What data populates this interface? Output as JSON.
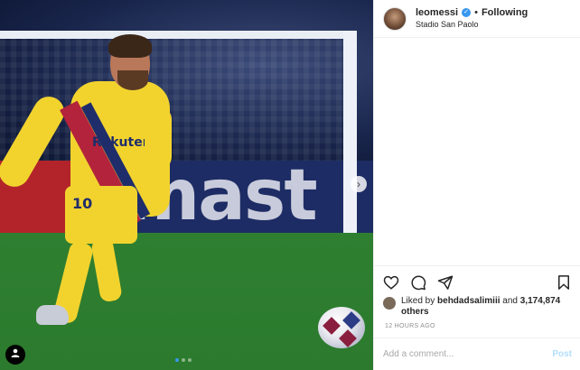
{
  "post": {
    "username": "leomessi",
    "verified_icon": "verified-badge-icon",
    "separator": "•",
    "follow_status": "Following",
    "location": "Stadio San Paolo",
    "photo": {
      "board_text": "mast",
      "jersey_number": "10",
      "sponsor": "Rakuten",
      "carousel_dots": 3,
      "active_dot": 1
    }
  },
  "actions": {
    "like_icon": "heart-icon",
    "comment_icon": "comment-icon",
    "share_icon": "share-icon",
    "save_icon": "bookmark-icon"
  },
  "likes": {
    "prefix": "Liked by ",
    "liker": "behdadsalimiii",
    "connector": " and",
    "count": "3,174,874 others"
  },
  "timestamp": "12 HOURS AGO",
  "comment": {
    "placeholder": "Add a comment...",
    "post_label": "Post"
  },
  "colors": {
    "accent": "#3897f0",
    "post_button_disabled": "#b2dffc",
    "jersey_yellow": "#f2d32e"
  }
}
